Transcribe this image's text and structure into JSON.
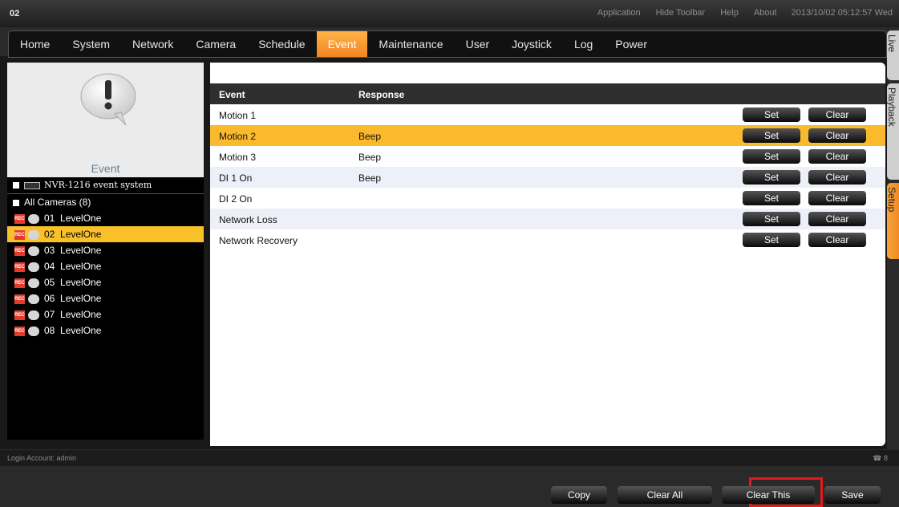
{
  "window": {
    "title": "02"
  },
  "topmenu": {
    "application": "Application",
    "hide_toolbar": "Hide Toolbar",
    "help": "Help",
    "about": "About",
    "clock": "2013/10/02 05:12:57 Wed"
  },
  "nav": {
    "items": [
      "Home",
      "System",
      "Network",
      "Camera",
      "Schedule",
      "Event",
      "Maintenance",
      "User",
      "Joystick",
      "Log",
      "Power"
    ],
    "active": "Event"
  },
  "sidebar": {
    "title": "Event",
    "system_label": "NVR-1216 event system",
    "group_label": "All Cameras (8)",
    "rec_badge": "REC",
    "cameras": [
      {
        "num": "01",
        "name": "LevelOne"
      },
      {
        "num": "02",
        "name": "LevelOne"
      },
      {
        "num": "03",
        "name": "LevelOne"
      },
      {
        "num": "04",
        "name": "LevelOne"
      },
      {
        "num": "05",
        "name": "LevelOne"
      },
      {
        "num": "06",
        "name": "LevelOne"
      },
      {
        "num": "07",
        "name": "LevelOne"
      },
      {
        "num": "08",
        "name": "LevelOne"
      }
    ],
    "selected_camera": "02"
  },
  "table": {
    "headers": {
      "event": "Event",
      "response": "Response"
    },
    "set_label": "Set",
    "clear_label": "Clear",
    "rows": [
      {
        "event": "Motion 1",
        "response": ""
      },
      {
        "event": "Motion 2",
        "response": "Beep"
      },
      {
        "event": "Motion 3",
        "response": "Beep"
      },
      {
        "event": "DI 1 On",
        "response": "Beep"
      },
      {
        "event": "DI 2 On",
        "response": ""
      },
      {
        "event": "Network Loss",
        "response": ""
      },
      {
        "event": "Network Recovery",
        "response": ""
      }
    ],
    "selected_row": "Motion 2"
  },
  "actions": {
    "copy": "Copy",
    "clear_all": "Clear All",
    "clear_this": "Clear This",
    "save": "Save"
  },
  "side_tabs": {
    "live": "Live",
    "playback": "Playback",
    "setup": "Setup",
    "active": "Setup"
  },
  "status": {
    "login": "Login Account: admin",
    "user_count": "8"
  },
  "colors": {
    "accent": "#f7a53c",
    "selected_row": "#fbb92d",
    "highlight_box": "#e41a1a"
  }
}
